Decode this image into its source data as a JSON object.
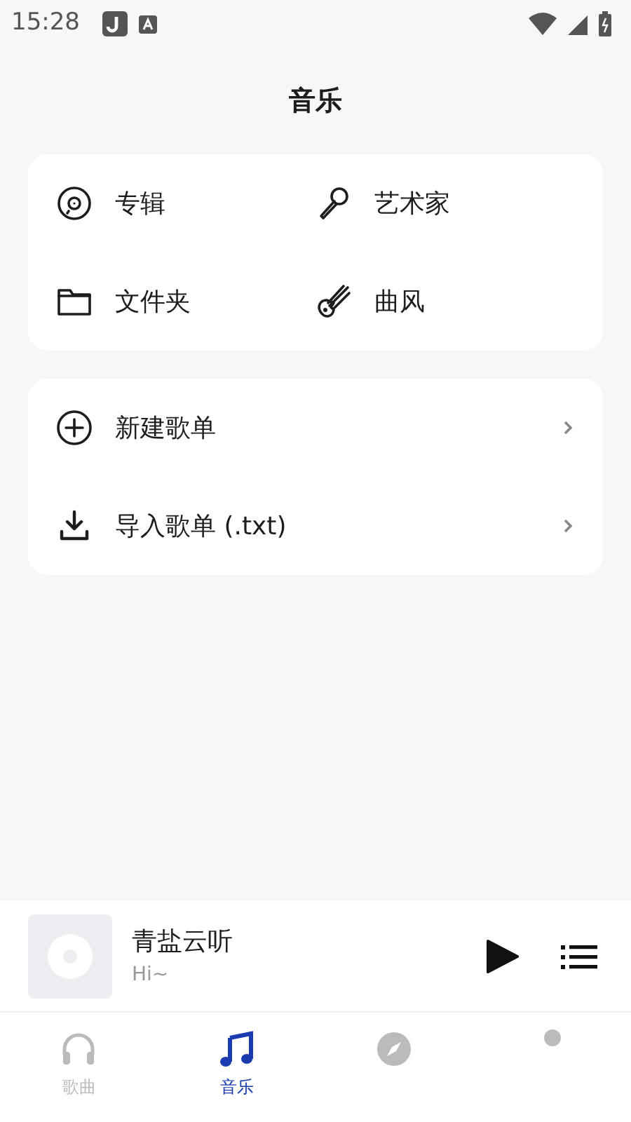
{
  "status_bar": {
    "time": "15:28"
  },
  "title": "音乐",
  "library": [
    {
      "kind": "album",
      "label": "专辑"
    },
    {
      "kind": "artist",
      "label": "艺术家"
    },
    {
      "kind": "folder",
      "label": "文件夹"
    },
    {
      "kind": "genre",
      "label": "曲风"
    }
  ],
  "playlist_actions": [
    {
      "kind": "add",
      "label": "新建歌单"
    },
    {
      "kind": "import",
      "label": "导入歌单 (.txt)"
    }
  ],
  "player": {
    "title": "青盐云听",
    "subtitle": "Hi~"
  },
  "tabs": [
    {
      "kind": "songs",
      "label": "歌曲",
      "selected": false
    },
    {
      "kind": "music",
      "label": "音乐",
      "selected": true
    },
    {
      "kind": "discover",
      "selected": false
    },
    {
      "kind": "me",
      "selected": false
    }
  ]
}
